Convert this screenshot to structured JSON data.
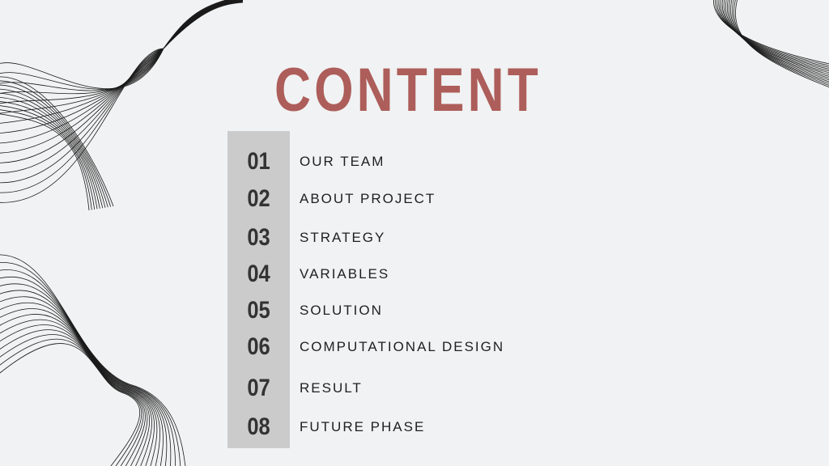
{
  "slide": {
    "title": "CONTENT",
    "accent_color": "#ad5e5a",
    "bar_color": "#cbcbcb",
    "items": [
      {
        "number": "01",
        "label": "OUR TEAM"
      },
      {
        "number": "02",
        "label": "ABOUT PROJECT"
      },
      {
        "number": "03",
        "label": "STRATEGY"
      },
      {
        "number": "04",
        "label": "VARIABLES"
      },
      {
        "number": "05",
        "label": "SOLUTION"
      },
      {
        "number": "06",
        "label": "COMPUTATIONAL DESIGN"
      },
      {
        "number": "07",
        "label": "RESULT"
      },
      {
        "number": "08",
        "label": "FUTURE PHASE"
      }
    ],
    "decorations": [
      "wave-lines-top-left",
      "wave-lines-bottom-left",
      "wave-lines-top-right"
    ]
  }
}
